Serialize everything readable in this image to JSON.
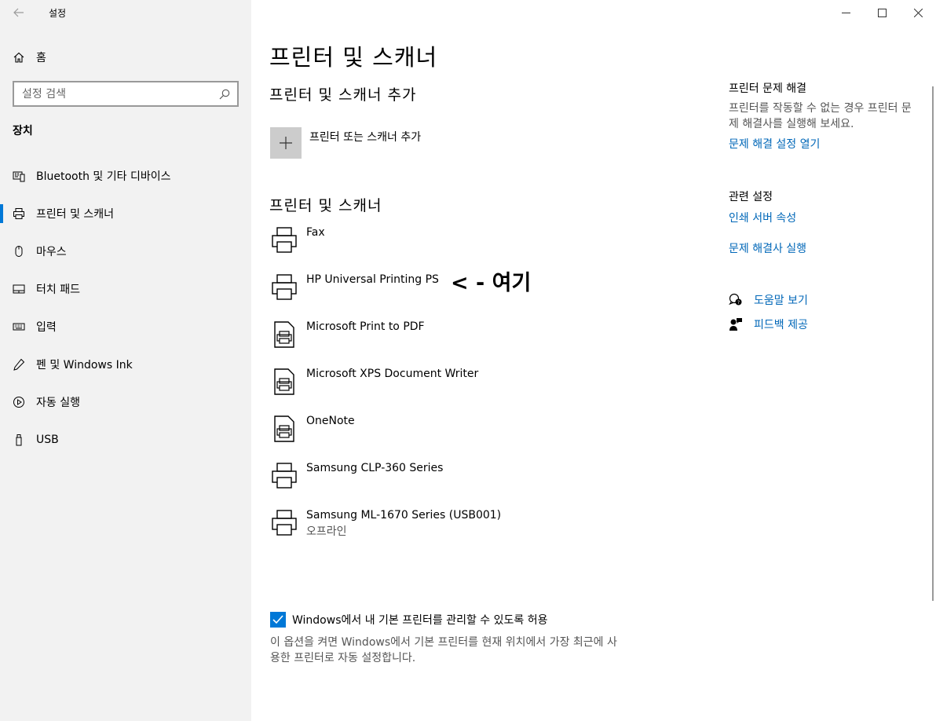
{
  "window": {
    "title": "설정",
    "back_icon": "arrow-left-icon",
    "controls": [
      "minimize-icon",
      "maximize-icon",
      "close-icon"
    ]
  },
  "sidebar": {
    "home_label": "홈",
    "search_placeholder": "설정 검색",
    "section_title": "장치",
    "items": [
      {
        "label": "Bluetooth 및 기타 디바이스",
        "icon": "bluetooth-devices-icon",
        "active": false
      },
      {
        "label": "프린터 및 스캐너",
        "icon": "printer-icon",
        "active": true
      },
      {
        "label": "마우스",
        "icon": "mouse-icon",
        "active": false
      },
      {
        "label": "터치 패드",
        "icon": "touchpad-icon",
        "active": false
      },
      {
        "label": "입력",
        "icon": "keyboard-icon",
        "active": false
      },
      {
        "label": "펜 및 Windows Ink",
        "icon": "pen-icon",
        "active": false
      },
      {
        "label": "자동 실행",
        "icon": "autoplay-icon",
        "active": false
      },
      {
        "label": "USB",
        "icon": "usb-icon",
        "active": false
      }
    ]
  },
  "main": {
    "title": "프린터 및 스캐너",
    "add_section_title": "프린터 및 스캐너 추가",
    "add_button_label": "프린터 또는 스캐너 추가",
    "list_section_title": "프린터 및 스캐너",
    "printers": [
      {
        "name": "Fax",
        "status": "",
        "icon": "printer-icon"
      },
      {
        "name": "HP Universal Printing PS",
        "status": "",
        "icon": "printer-icon"
      },
      {
        "name": "Microsoft Print to PDF",
        "status": "",
        "icon": "document-printer-icon"
      },
      {
        "name": "Microsoft XPS Document Writer",
        "status": "",
        "icon": "document-printer-icon"
      },
      {
        "name": "OneNote",
        "status": "",
        "icon": "document-printer-icon"
      },
      {
        "name": "Samsung CLP-360 Series",
        "status": "",
        "icon": "printer-icon"
      },
      {
        "name": "Samsung ML-1670 Series (USB001)",
        "status": "오프라인",
        "icon": "printer-icon"
      }
    ],
    "annotation": "< - 여기",
    "default_printer_checkbox": {
      "label": "Windows에서 내 기본 프린터를 관리할 수 있도록 허용",
      "checked": true,
      "description": "이 옵션을 켜면 Windows에서 기본 프린터를 현재 위치에서 가장 최근에 사용한 프린터로 자동 설정합니다."
    }
  },
  "right_panel": {
    "troubleshoot_heading": "프린터 문제 해결",
    "troubleshoot_text": "프린터를 작동할 수 없는 경우 프린터 문제 해결사를 실행해 보세요.",
    "troubleshoot_link": "문제 해결 설정 열기",
    "related_heading": "관련 설정",
    "related_links": [
      "인쇄 서버 속성",
      "문제 해결사 실행"
    ],
    "help_link": "도움말 보기",
    "feedback_link": "피드백 제공"
  },
  "colors": {
    "accent": "#0078d7",
    "link": "#0067b8",
    "sidebar_bg": "#f2f2f2"
  }
}
